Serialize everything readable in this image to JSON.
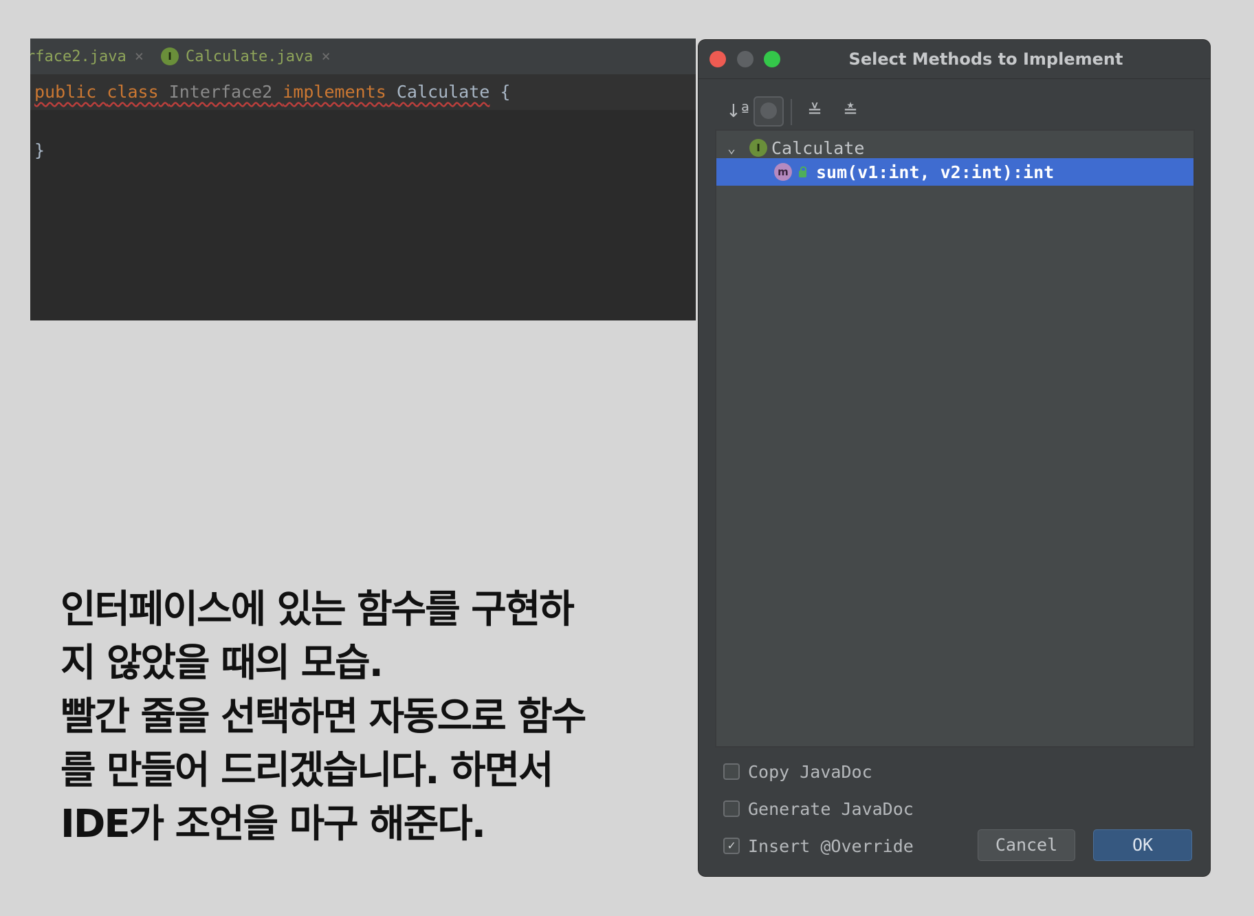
{
  "editor": {
    "tabs": [
      {
        "label": "rface2.java",
        "close": "×"
      },
      {
        "icon_letter": "I",
        "label": "Calculate.java",
        "close": "×"
      }
    ],
    "code": {
      "kw_public": "public",
      "kw_class": "class",
      "class_name": "Interface2",
      "kw_implements": "implements",
      "iface_name": "Calculate",
      "brace_open": "{",
      "brace_close": "}"
    }
  },
  "caption": {
    "line1": "인터페이스에 있는 함수를 구현하",
    "line2": "지 않았을 때의 모습.",
    "line3": "빨간 줄을 선택하면 자동으로 함수",
    "line4": "를 만들어 드리겠습니다. 하면서",
    "line5": "IDE가 조언을 마구 해준다."
  },
  "dialog": {
    "title": "Select Methods to Implement",
    "toolbar": {
      "sort_icon": "↓ª",
      "expand_icon": "≚",
      "collapse_icon": "≛"
    },
    "tree": {
      "interface_icon_letter": "I",
      "interface_name": "Calculate",
      "method_icon_letter": "m",
      "method_signature": "sum(v1:int, v2:int):int"
    },
    "options": {
      "copy_javadoc": "Copy JavaDoc",
      "generate_javadoc": "Generate JavaDoc",
      "insert_override": "Insert @Override",
      "insert_override_checked": true,
      "check_mark": "✓"
    },
    "buttons": {
      "cancel": "Cancel",
      "ok": "OK"
    }
  },
  "colors": {
    "selection": "#3f6cd0",
    "keyword": "#cc7832",
    "error_underline": "#bc3f3c",
    "ok_button": "#365880"
  }
}
